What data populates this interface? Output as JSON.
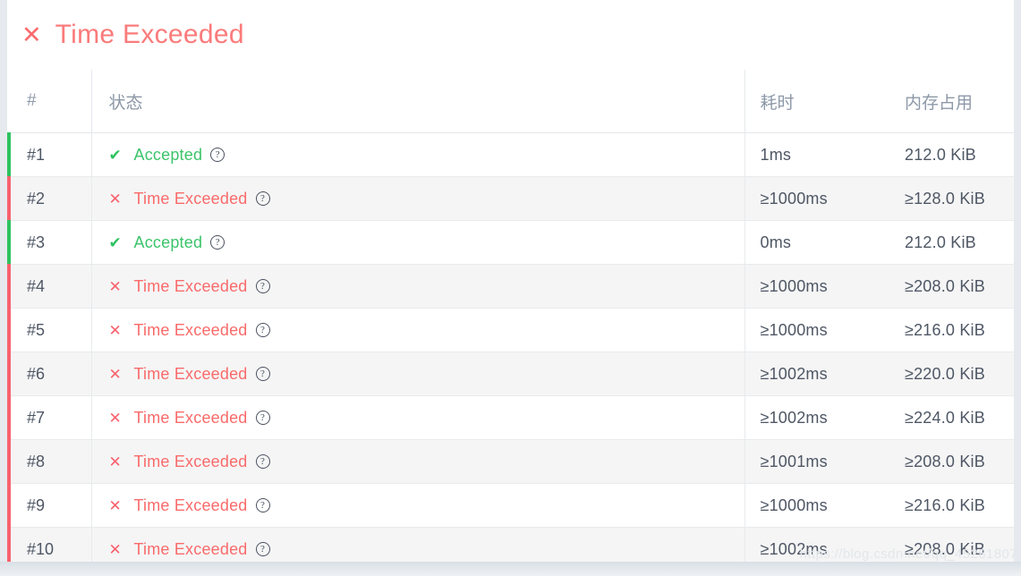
{
  "header": {
    "icon": "cross-icon",
    "title": "Time Exceeded"
  },
  "table": {
    "columns": {
      "num": "#",
      "status": "状态",
      "time": "耗时",
      "memory": "内存占用"
    },
    "help_icon_glyph": "?",
    "accepted_icon": "✔",
    "failed_icon": "✕",
    "rows": [
      {
        "num": "#1",
        "status": "Accepted",
        "state": "ok",
        "time": "1ms",
        "memory": "212.0 KiB"
      },
      {
        "num": "#2",
        "status": "Time Exceeded",
        "state": "bad",
        "time": "≥1000ms",
        "memory": "≥128.0 KiB"
      },
      {
        "num": "#3",
        "status": "Accepted",
        "state": "ok",
        "time": "0ms",
        "memory": "212.0 KiB"
      },
      {
        "num": "#4",
        "status": "Time Exceeded",
        "state": "bad",
        "time": "≥1000ms",
        "memory": "≥208.0 KiB"
      },
      {
        "num": "#5",
        "status": "Time Exceeded",
        "state": "bad",
        "time": "≥1000ms",
        "memory": "≥216.0 KiB"
      },
      {
        "num": "#6",
        "status": "Time Exceeded",
        "state": "bad",
        "time": "≥1002ms",
        "memory": "≥220.0 KiB"
      },
      {
        "num": "#7",
        "status": "Time Exceeded",
        "state": "bad",
        "time": "≥1002ms",
        "memory": "≥224.0 KiB"
      },
      {
        "num": "#8",
        "status": "Time Exceeded",
        "state": "bad",
        "time": "≥1001ms",
        "memory": "≥208.0 KiB"
      },
      {
        "num": "#9",
        "status": "Time Exceeded",
        "state": "bad",
        "time": "≥1000ms",
        "memory": "≥216.0 KiB"
      },
      {
        "num": "#10",
        "status": "Time Exceeded",
        "state": "bad",
        "time": "≥1002ms",
        "memory": "≥208.0 KiB"
      }
    ]
  },
  "watermark": "https://blog.csdn.net/qq_45281807",
  "colors": {
    "accent_red": "#fa6a6a",
    "accent_green": "#3cc46b",
    "bar_red": "#f8616e",
    "bar_green": "#2ec25f",
    "header_text": "#8d98a8",
    "body_text": "#4e5765",
    "stripe": "#f5f5f5"
  }
}
